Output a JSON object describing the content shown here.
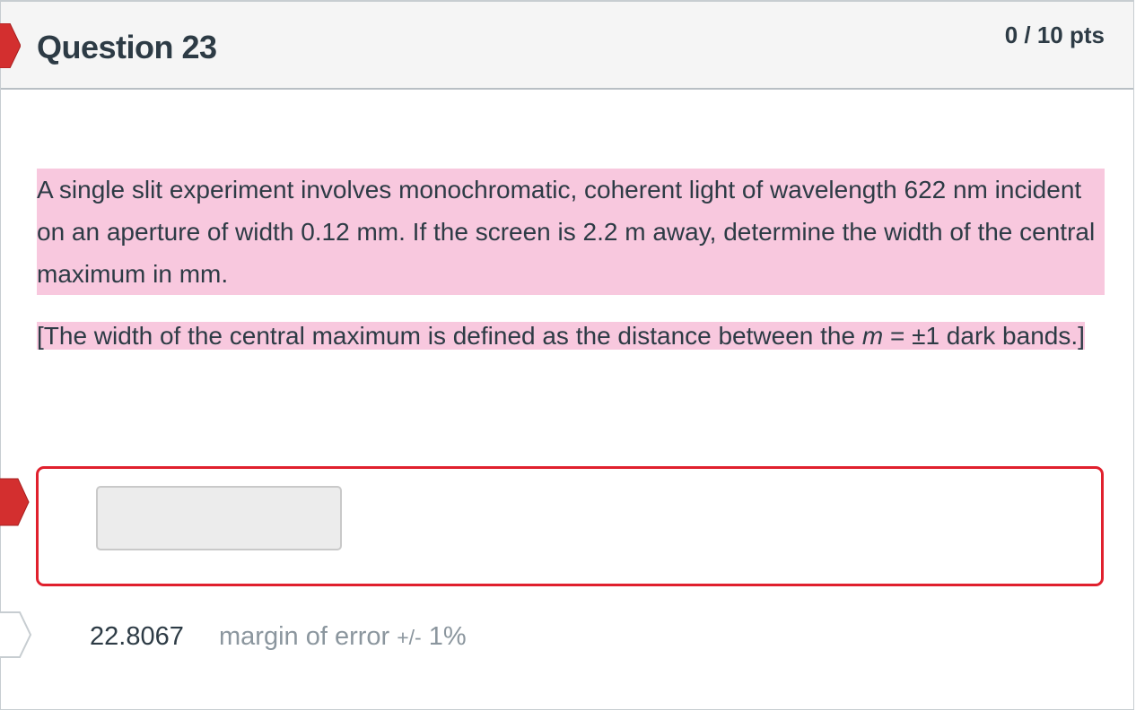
{
  "question": {
    "title": "Question 23",
    "points": "0 / 10 pts",
    "text_line": "A single slit experiment involves monochromatic, coherent light of wavelength 622 nm incident on an aperture of width 0.12 mm. If the screen is 2.2 m away, determine the width of the central maximum in mm.",
    "definition_prefix": "[The width of the central maximum is defined as the distance between the ",
    "definition_var": "m",
    "definition_suffix": " = ±1 dark bands.]"
  },
  "answer": {
    "student_value": "",
    "correct_value": "22.8067",
    "margin_label": "margin of error",
    "margin_pm": "+/-",
    "margin_value": "1%"
  },
  "colors": {
    "highlight": "#f8c8de",
    "incorrect_border": "#e0202d",
    "flag_red": "#d32f2f"
  },
  "icons": {
    "header_flag": "incorrect-flag-icon",
    "answer_pointer": "incorrect-answer-arrow-icon",
    "correct_pointer": "correct-answer-arrow-icon"
  }
}
